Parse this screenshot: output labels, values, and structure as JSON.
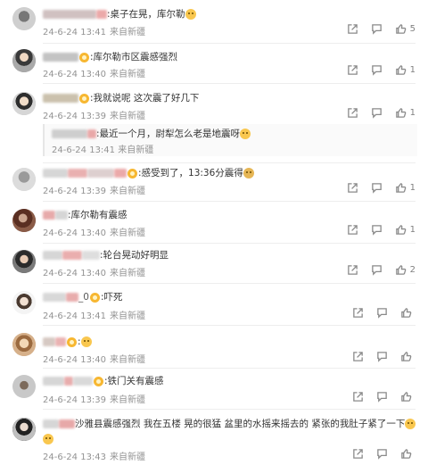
{
  "icons": {
    "share": "share-icon",
    "comment": "comment-icon",
    "like": "like-icon",
    "badge": "fan-badge-icon",
    "emoji": "emoji-icon"
  },
  "colors": {
    "meta": "#939393",
    "divider": "#ededed",
    "badge": "#f7b731"
  },
  "comments": [
    {
      "user": "",
      "text": ":桌子在晃，库尔勒",
      "time": "24-6-24 13:41",
      "source": "来自新疆",
      "likes": "5"
    },
    {
      "user": "",
      "text": ":库尔勒市区震感强烈",
      "time": "24-6-24 13:40",
      "source": "来自新疆",
      "likes": "1"
    },
    {
      "user": "",
      "text": ":我就说呢 这次震了好几下",
      "time": "24-6-24 13:39",
      "source": "来自新疆",
      "likes": "1",
      "reply": {
        "user": "",
        "text": ":最近一个月，尉犁怎么老是地震呀",
        "time": "24-6-24 13:41",
        "source": "来自新疆"
      }
    },
    {
      "user": "",
      "text": ":感受到了，13:36分震得",
      "time": "24-6-24 13:39",
      "source": "来自新疆",
      "likes": "1"
    },
    {
      "user": "",
      "text": ":库尔勒有震感",
      "time": "24-6-24 13:40",
      "source": "来自新疆",
      "likes": "1"
    },
    {
      "user": "",
      "text": ":轮台晃动好明显",
      "time": "24-6-24 13:40",
      "source": "来自新疆",
      "likes": "2"
    },
    {
      "user": "_0",
      "text": ":吓死",
      "time": "24-6-24 13:41",
      "source": "来自新疆",
      "likes": ""
    },
    {
      "user": "",
      "text": ":",
      "time": "24-6-24 13:40",
      "source": "来自新疆",
      "likes": ""
    },
    {
      "user": "",
      "text": ":铁门关有震感",
      "time": "24-6-24 13:39",
      "source": "来自新疆",
      "likes": ""
    },
    {
      "user": "",
      "text": "沙雅县震感强烈 我在五楼 晃的很猛  盆里的水摇来摇去的  紧张的我肚子紧了一下",
      "time": "24-6-24 13:43",
      "source": "来自新疆",
      "likes": ""
    }
  ]
}
